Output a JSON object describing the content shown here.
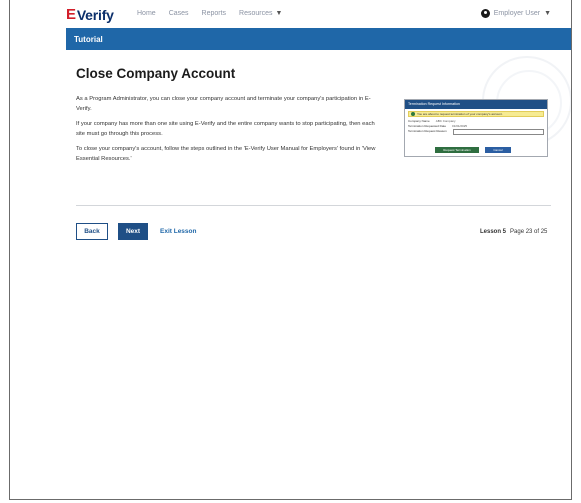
{
  "header": {
    "brand_prefix": "E",
    "brand_rest": "Verify",
    "nav": [
      {
        "label": "Home",
        "has_dropdown": false
      },
      {
        "label": "Cases",
        "has_dropdown": false
      },
      {
        "label": "Reports",
        "has_dropdown": false
      },
      {
        "label": "Resources",
        "has_dropdown": true
      }
    ],
    "user_label": "Employer User"
  },
  "banner": {
    "title": "Tutorial"
  },
  "main": {
    "title": "Close Company Account",
    "paragraphs": [
      "As a Program Administrator, you can close your company account and terminate your company's participation in E-Verify.",
      "If your company has more than one site using E-Verify and the entire company wants to stop participating, then each site must go through this process.",
      "To close your company's account, follow the steps outlined in the 'E-Verify User Manual for Employers' found in 'View Essential Resources.'"
    ]
  },
  "thumbnail": {
    "header": "Termination Request Information",
    "alert": "You are about to request termination of your company's account.",
    "rows": [
      {
        "label": "Company Name",
        "value": "ABC Company"
      },
      {
        "label": "Termination Requested Date",
        "value": "01/01/2025"
      }
    ],
    "field_label": "Termination Request Reason",
    "primary_button": "Request Termination",
    "secondary_button": "Cancel"
  },
  "footer": {
    "back_label": "Back",
    "next_label": "Next",
    "exit_label": "Exit Lesson",
    "lesson_label": "Lesson 5",
    "page_label": "Page 23 of 25"
  },
  "colors": {
    "brand_blue": "#1f4f86",
    "banner_blue": "#1f67a8",
    "brand_red": "#d21f2b"
  }
}
